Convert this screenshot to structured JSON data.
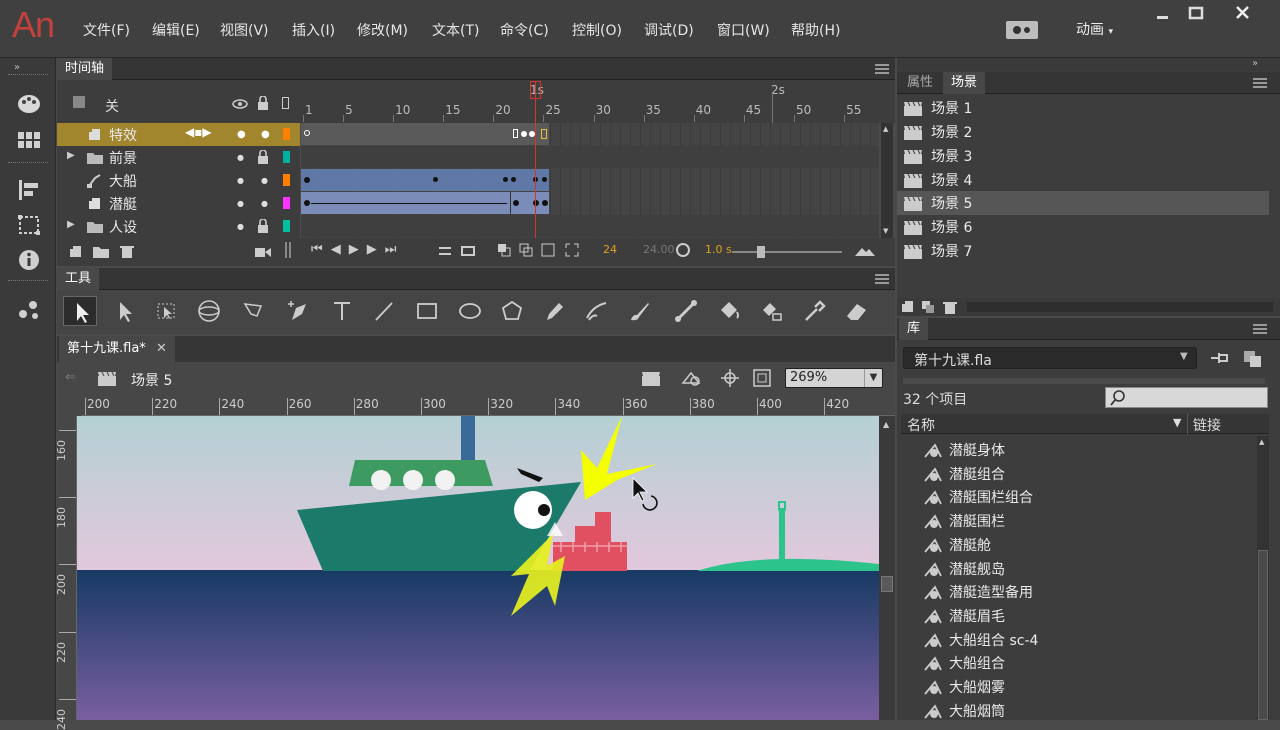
{
  "app": {
    "logo": "An",
    "workspace": "动画"
  },
  "menu": [
    "文件(F)",
    "编辑(E)",
    "视图(V)",
    "插入(I)",
    "修改(M)",
    "文本(T)",
    "命令(C)",
    "控制(O)",
    "调试(D)",
    "窗口(W)",
    "帮助(H)"
  ],
  "timeline": {
    "tab": "时间轴",
    "header_label": "关",
    "ruler_marks": [
      "1s",
      "2s"
    ],
    "frame_numbers": [
      "1",
      "5",
      "10",
      "15",
      "20",
      "25",
      "30",
      "35",
      "40",
      "45",
      "50",
      "55"
    ],
    "layers": [
      {
        "name": "特效",
        "type": "layer",
        "selected": true,
        "color": "#ff7f00"
      },
      {
        "name": "前景",
        "type": "folder",
        "color": "#00b0a0"
      },
      {
        "name": "大船",
        "type": "guide",
        "color": "#ff7f00"
      },
      {
        "name": "潜艇",
        "type": "layer",
        "color": "#ff33ff"
      },
      {
        "name": "人设",
        "type": "folder",
        "color": "#00c0a0"
      }
    ],
    "fps": "24",
    "time": "24.00",
    "elapsed": "1.0 s",
    "playhead_frame": 24
  },
  "props": {
    "tabs": [
      "属性",
      "场景"
    ],
    "active_tab": "场景",
    "scenes": [
      "场景 1",
      "场景 2",
      "场景 3",
      "场景 4",
      "场景 5",
      "场景 6",
      "场景 7"
    ],
    "selected_scene": "场景 5"
  },
  "tools": {
    "tab": "工具",
    "items": [
      "selection",
      "subselection",
      "free-transform",
      "3d-rotation",
      "lasso",
      "pen",
      "text",
      "line",
      "rectangle",
      "oval",
      "polystar",
      "pencil",
      "brush",
      "paint-brush",
      "bone",
      "paint-bucket",
      "ink-bottle",
      "eyedropper",
      "eraser"
    ]
  },
  "stage": {
    "doc_tab": "第十九课.fla*",
    "scene_label": "场景 5",
    "zoom": "269%",
    "h_ruler": [
      "200",
      "220",
      "240",
      "260",
      "280",
      "300",
      "320",
      "340",
      "360",
      "380",
      "400",
      "420"
    ],
    "v_ruler": [
      "160",
      "180",
      "200",
      "220",
      "240"
    ]
  },
  "library": {
    "tab": "库",
    "doc": "第十九课.fla",
    "count": "32 个项目",
    "search_placeholder": "",
    "col_name": "名称",
    "col_link": "链接",
    "items": [
      "潜艇身体",
      "潜艇组合",
      "潜艇围栏组合",
      "潜艇围栏",
      "潜艇舱",
      "潜艇舰岛",
      "潜艇造型备用",
      "潜艇眉毛",
      "大船组合 sc-4",
      "大船组合",
      "大船烟雾",
      "大船烟筒"
    ]
  }
}
